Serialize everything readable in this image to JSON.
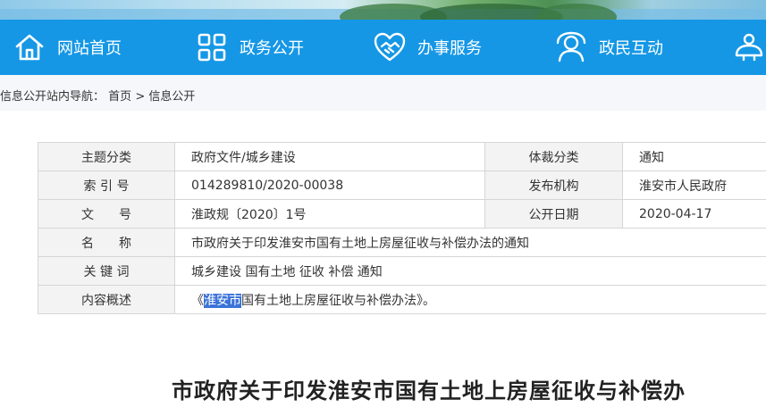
{
  "nav": {
    "items": [
      {
        "label": "网站首页",
        "icon": "home-icon"
      },
      {
        "label": "政务公开",
        "icon": "grid-icon"
      },
      {
        "label": "办事服务",
        "icon": "handshake-heart-icon"
      },
      {
        "label": "政民互动",
        "icon": "chat-person-icon"
      },
      {
        "label": "",
        "icon": "service-icon"
      }
    ]
  },
  "breadcrumb": {
    "prefix": "信息公开站内导航：",
    "home": "首页",
    "sep": ">",
    "current": "信息公开"
  },
  "meta": {
    "theme_label": "主题分类",
    "theme_value": "政府文件/城乡建设",
    "genre_label": "体裁分类",
    "genre_value": "通知",
    "index_label": "索 引 号",
    "index_value": "014289810/2020-00038",
    "publisher_label": "发布机构",
    "publisher_value": "淮安市人民政府",
    "docno_label": "文　　号",
    "docno_value": "淮政规〔2020〕1号",
    "date_label": "公开日期",
    "date_value": "2020-04-17",
    "name_label": "名　　称",
    "name_value": "市政府关于印发淮安市国有土地上房屋征收与补偿办法的通知",
    "keywords_label": "关 键 词",
    "keywords_value": "城乡建设 国有土地 征收 补偿 通知",
    "summary_label": "内容概述",
    "summary_pre": "《",
    "summary_highlight": "淮安市",
    "summary_post": "国有土地上房屋征收与补偿办法》。"
  },
  "document": {
    "title": "市政府关于印发淮安市国有土地上房屋征收与补偿办"
  },
  "colors": {
    "nav_bg": "#1597e5",
    "selection": "#3b73d8"
  }
}
